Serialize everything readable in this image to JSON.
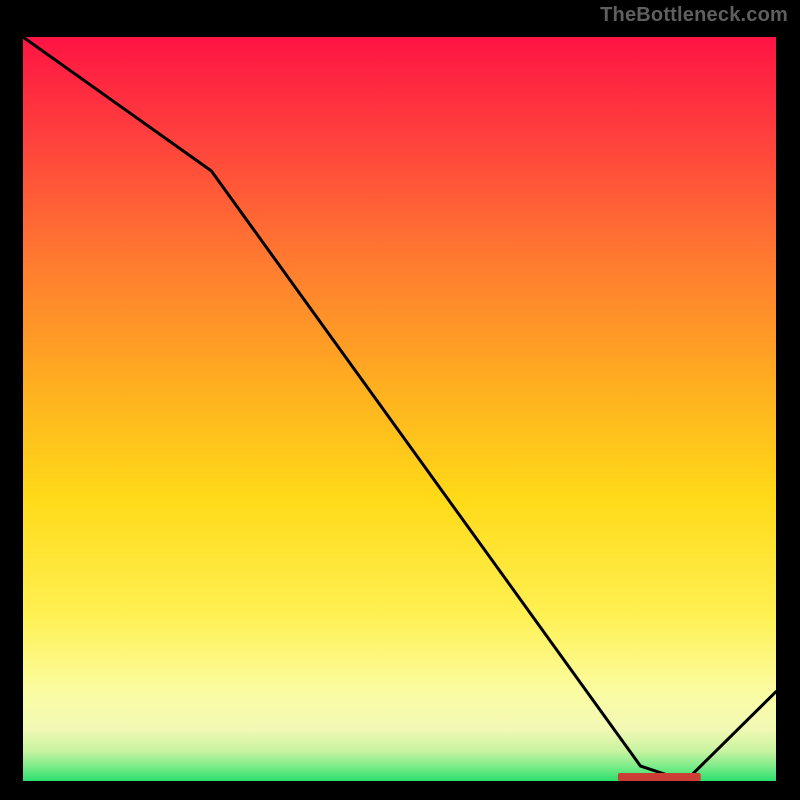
{
  "attribution": "TheBottleneck.com",
  "colors": {
    "top": "#ff1846",
    "mid_upper": "#ff7a30",
    "mid": "#ffd219",
    "mid_lower": "#fff56a",
    "pale": "#fbfca9",
    "green": "#2ee871",
    "line": "#000000",
    "marker": "#cb3d35",
    "frame": "#000000",
    "attr_text": "#5f5f5f"
  },
  "chart_data": {
    "type": "line",
    "title": "",
    "xlabel": "",
    "ylabel": "",
    "xlim": [
      0,
      100
    ],
    "ylim": [
      0,
      100
    ],
    "x": [
      0,
      25,
      82,
      88,
      100
    ],
    "values": [
      100,
      82,
      2,
      0,
      12
    ],
    "optimum_band": {
      "x_start": 79,
      "x_end": 90,
      "y": 0
    },
    "notes": "Vertical gradient from red (top) through orange/yellow to pale, with thin green band at bottom. Black curve descends from top-left, knee near x≈25, reaches 0 near x≈86, rises to ≈12 at right edge. Red marker segment sits at y≈0 over x≈79–90."
  }
}
